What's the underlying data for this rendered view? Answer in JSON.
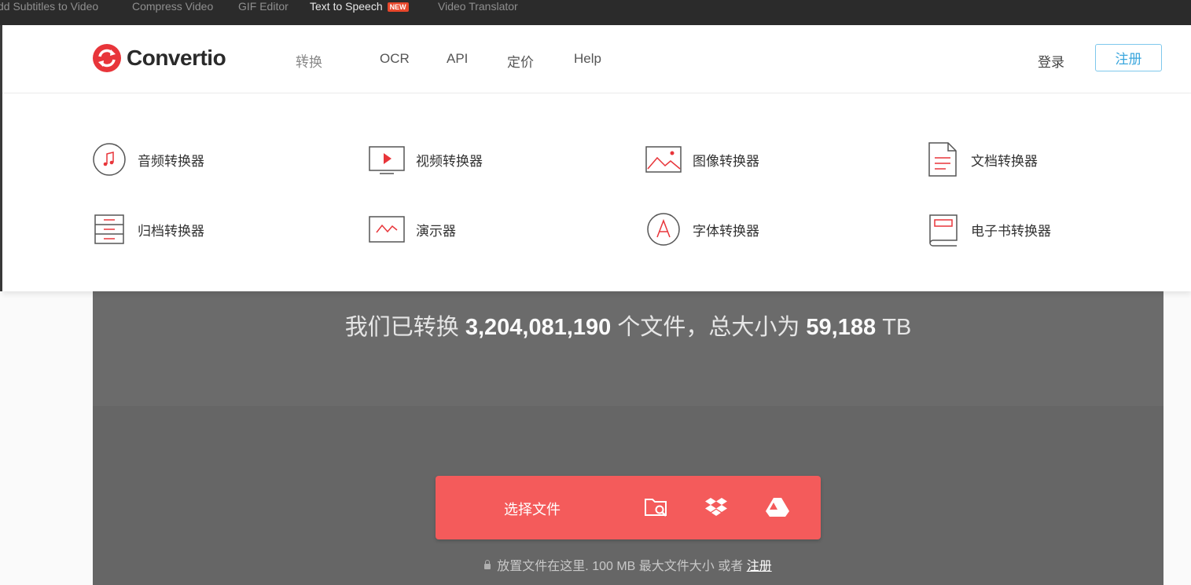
{
  "topbar": {
    "items": [
      {
        "label": "dd Subtitles to Video"
      },
      {
        "label": "Compress Video"
      },
      {
        "label": "GIF Editor"
      },
      {
        "label": "Text to Speech",
        "badge": "NEW"
      },
      {
        "label": "Video Translator"
      }
    ]
  },
  "header": {
    "logo_text": "Convertio",
    "nav": [
      {
        "label": "转换",
        "has_dropdown": true
      },
      {
        "label": "OCR"
      },
      {
        "label": "API"
      },
      {
        "label": "定价"
      },
      {
        "label": "Help"
      }
    ],
    "login_label": "登录",
    "signup_label": "注册"
  },
  "dropdown": {
    "items": [
      {
        "label": "音频转换器",
        "icon": "music-note-icon"
      },
      {
        "label": "视频转换器",
        "icon": "video-play-icon"
      },
      {
        "label": "图像转换器",
        "icon": "image-icon"
      },
      {
        "label": "文档转换器",
        "icon": "document-icon"
      },
      {
        "label": "归档转换器",
        "icon": "archive-icon"
      },
      {
        "label": "演示器",
        "icon": "presentation-icon"
      },
      {
        "label": "字体转换器",
        "icon": "font-icon"
      },
      {
        "label": "电子书转换器",
        "icon": "ebook-icon"
      }
    ]
  },
  "hero": {
    "stats_prefix": "我们已转换",
    "files_count": "3,204,081,190",
    "stats_middle": "个文件，总大小为",
    "total_size": "59,188",
    "size_unit": "TB",
    "upload_label": "选择文件",
    "hint_text": "放置文件在这里. 100 MB 最大文件大小 或者",
    "hint_link": "注册"
  },
  "colors": {
    "brand_red": "#f45b5b",
    "signup_blue": "#3aa6dd",
    "hero_bg": "#6b6b6b",
    "topbar_bg": "#2b2b2b"
  }
}
